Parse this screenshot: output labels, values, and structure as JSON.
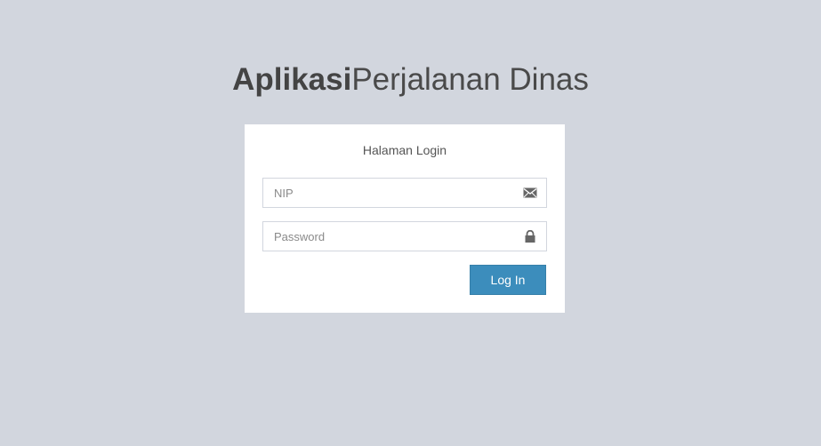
{
  "logo": {
    "bold": "Aplikasi",
    "light": "Perjalanan Dinas"
  },
  "login": {
    "title": "Halaman Login",
    "nip_placeholder": "NIP",
    "nip_icon": "envelope-icon",
    "password_placeholder": "Password",
    "password_icon": "lock-icon",
    "submit_label": "Log In"
  },
  "colors": {
    "background": "#d2d6de",
    "primary": "#3c8dbc",
    "box": "#ffffff"
  }
}
